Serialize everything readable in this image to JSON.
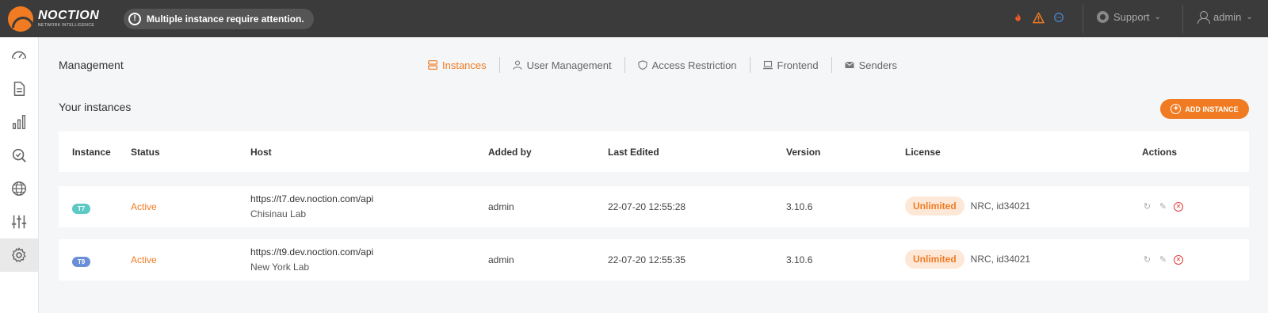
{
  "brand": {
    "name": "NOCTION",
    "tagline": "NETWORK INTELLIGENCE",
    "accent": "#f07b22"
  },
  "alert": {
    "text": "Multiple instance require attention."
  },
  "topbar": {
    "icons": [
      "fire-icon",
      "warning-icon",
      "chat-icon"
    ],
    "support_label": "Support",
    "user_label": "admin"
  },
  "sidebar": {
    "items": [
      {
        "name": "dashboard",
        "icon": "speedometer-icon"
      },
      {
        "name": "reports",
        "icon": "document-icon"
      },
      {
        "name": "graphs",
        "icon": "bar-chart-icon"
      },
      {
        "name": "search",
        "icon": "search-check-icon"
      },
      {
        "name": "network",
        "icon": "globe-icon"
      },
      {
        "name": "configuration",
        "icon": "sliders-icon"
      },
      {
        "name": "settings",
        "icon": "gear-icon",
        "active": true
      }
    ]
  },
  "page": {
    "title": "Management",
    "tabs": [
      {
        "label": "Instances",
        "icon": "server-icon",
        "active": true
      },
      {
        "label": "User Management",
        "icon": "user-icon"
      },
      {
        "label": "Access Restriction",
        "icon": "shield-icon"
      },
      {
        "label": "Frontend",
        "icon": "laptop-icon"
      },
      {
        "label": "Senders",
        "icon": "envelope-icon"
      }
    ],
    "section_title": "Your instances",
    "add_button_label": "ADD INSTANCE"
  },
  "table": {
    "columns": [
      "Instance",
      "Status",
      "Host",
      "Added by",
      "Last Edited",
      "Version",
      "License",
      "Actions"
    ],
    "rows": [
      {
        "instance": "T7",
        "badge_color": "#5cc9c4",
        "status": "Active",
        "host_url": "https://t7.dev.noction.com/api",
        "host_location": "Chisinau Lab",
        "added_by": "admin",
        "last_edited": "22-07-20 12:55:28",
        "version": "3.10.6",
        "license": "Unlimited",
        "license_extra": "NRC, id34021"
      },
      {
        "instance": "T9",
        "badge_color": "#6a8fd6",
        "status": "Active",
        "host_url": "https://t9.dev.noction.com/api",
        "host_location": "New York Lab",
        "added_by": "admin",
        "last_edited": "22-07-20 12:55:35",
        "version": "3.10.6",
        "license": "Unlimited",
        "license_extra": "NRC, id34021"
      }
    ]
  }
}
